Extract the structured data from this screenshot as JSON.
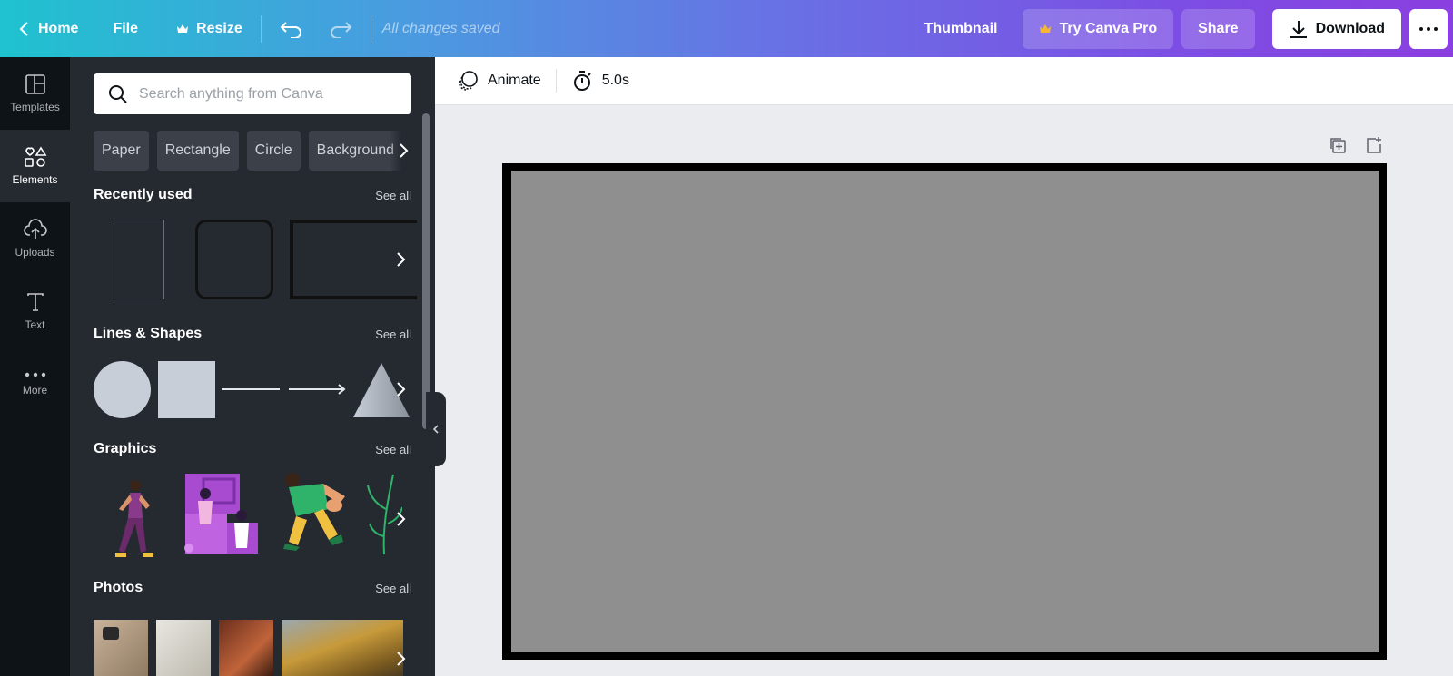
{
  "topbar": {
    "home": "Home",
    "file": "File",
    "resize": "Resize",
    "saved_status": "All changes saved",
    "design_title": "Thumbnail",
    "try_pro": "Try Canva Pro",
    "share": "Share",
    "download": "Download"
  },
  "rail": {
    "items": [
      {
        "label": "Templates",
        "icon": "templates-icon"
      },
      {
        "label": "Elements",
        "icon": "elements-icon"
      },
      {
        "label": "Uploads",
        "icon": "uploads-icon"
      },
      {
        "label": "Text",
        "icon": "text-icon"
      },
      {
        "label": "More",
        "icon": "more-icon"
      }
    ]
  },
  "panel": {
    "search_placeholder": "Search anything from Canva",
    "chips": [
      "Paper",
      "Rectangle",
      "Circle",
      "Background"
    ],
    "recent": {
      "title": "Recently used",
      "see_all": "See all"
    },
    "shapes": {
      "title": "Lines & Shapes",
      "see_all": "See all"
    },
    "graphics": {
      "title": "Graphics",
      "see_all": "See all"
    },
    "photos": {
      "title": "Photos",
      "see_all": "See all"
    }
  },
  "editor": {
    "animate": "Animate",
    "duration": "5.0s"
  },
  "colors": {
    "canvas_fill": "#8f8f8f",
    "canvas_border": "#000000",
    "panel_bg": "#252a31",
    "rail_bg": "#0e1318",
    "shape_fill": "#c8ced8"
  }
}
